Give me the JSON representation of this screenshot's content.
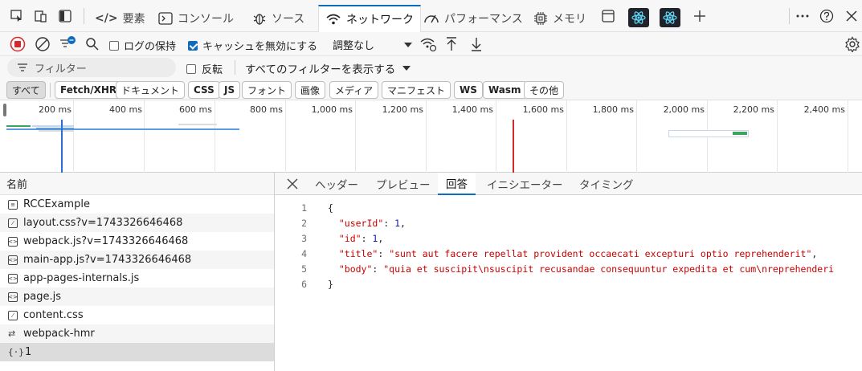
{
  "tabs": [
    {
      "label": "要素",
      "icon": "code-brackets-icon"
    },
    {
      "label": "コンソール",
      "icon": "console-icon"
    },
    {
      "label": "ソース",
      "icon": "bug-icon"
    },
    {
      "label": "ネットワーク",
      "icon": "wifi-icon"
    },
    {
      "label": "パフォーマンス",
      "icon": "gauge-icon"
    },
    {
      "label": "メモリ",
      "icon": "chip-icon"
    }
  ],
  "toolbar": {
    "preserve_log": "ログの保持",
    "disable_cache": "キャッシュを無効にする",
    "throttling": "調整なし"
  },
  "filter": {
    "placeholder": "フィルター",
    "invert": "反転",
    "show_all": "すべてのフィルターを表示する"
  },
  "type_chips": [
    "すべて",
    "Fetch/XHR",
    "ドキュメント",
    "CSS",
    "JS",
    "フォント",
    "画像",
    "メディア",
    "マニフェスト",
    "WS",
    "Wasm",
    "その他"
  ],
  "overview": {
    "ticks": [
      "200 ms",
      "400 ms",
      "600 ms",
      "800 ms",
      "1,000 ms",
      "1,200 ms",
      "1,400 ms",
      "1,600 ms",
      "1,800 ms",
      "2,000 ms",
      "2,200 ms",
      "2,400 ms"
    ]
  },
  "request_list": {
    "header": "名前",
    "items": [
      {
        "name": "RCCExample",
        "icon": "document-icon"
      },
      {
        "name": "layout.css?v=1743326646468",
        "icon": "stylesheet-icon"
      },
      {
        "name": "webpack.js?v=1743326646468",
        "icon": "script-icon"
      },
      {
        "name": "main-app.js?v=1743326646468",
        "icon": "script-icon"
      },
      {
        "name": "app-pages-internals.js",
        "icon": "script-icon"
      },
      {
        "name": "page.js",
        "icon": "script-icon"
      },
      {
        "name": "content.css",
        "icon": "stylesheet-icon"
      },
      {
        "name": "webpack-hmr",
        "icon": "websocket-icon"
      },
      {
        "name": "1",
        "icon": "fetch-icon"
      }
    ]
  },
  "detail": {
    "tabs": [
      "ヘッダー",
      "プレビュー",
      "回答",
      "イニシエーター",
      "タイミング"
    ],
    "lines": [
      {
        "num": "1",
        "text": "{"
      },
      {
        "num": "2",
        "key": "\"userId\"",
        "value": "1",
        "vtype": "n",
        "comma": ","
      },
      {
        "num": "3",
        "key": "\"id\"",
        "value": "1",
        "vtype": "n",
        "comma": ","
      },
      {
        "num": "4",
        "key": "\"title\"",
        "value": "\"sunt aut facere repellat provident occaecati excepturi optio reprehenderit\"",
        "vtype": "s",
        "comma": ","
      },
      {
        "num": "5",
        "key": "\"body\"",
        "value": "\"quia et suscipit\\nsuscipit recusandae consequuntur expedita et cum\\nreprehenderi",
        "vtype": "s",
        "comma": ""
      },
      {
        "num": "6",
        "text": "}"
      }
    ]
  },
  "colors": {
    "accent": "#0f6cbd",
    "record": "#d3292c",
    "react": "#61dafb"
  }
}
